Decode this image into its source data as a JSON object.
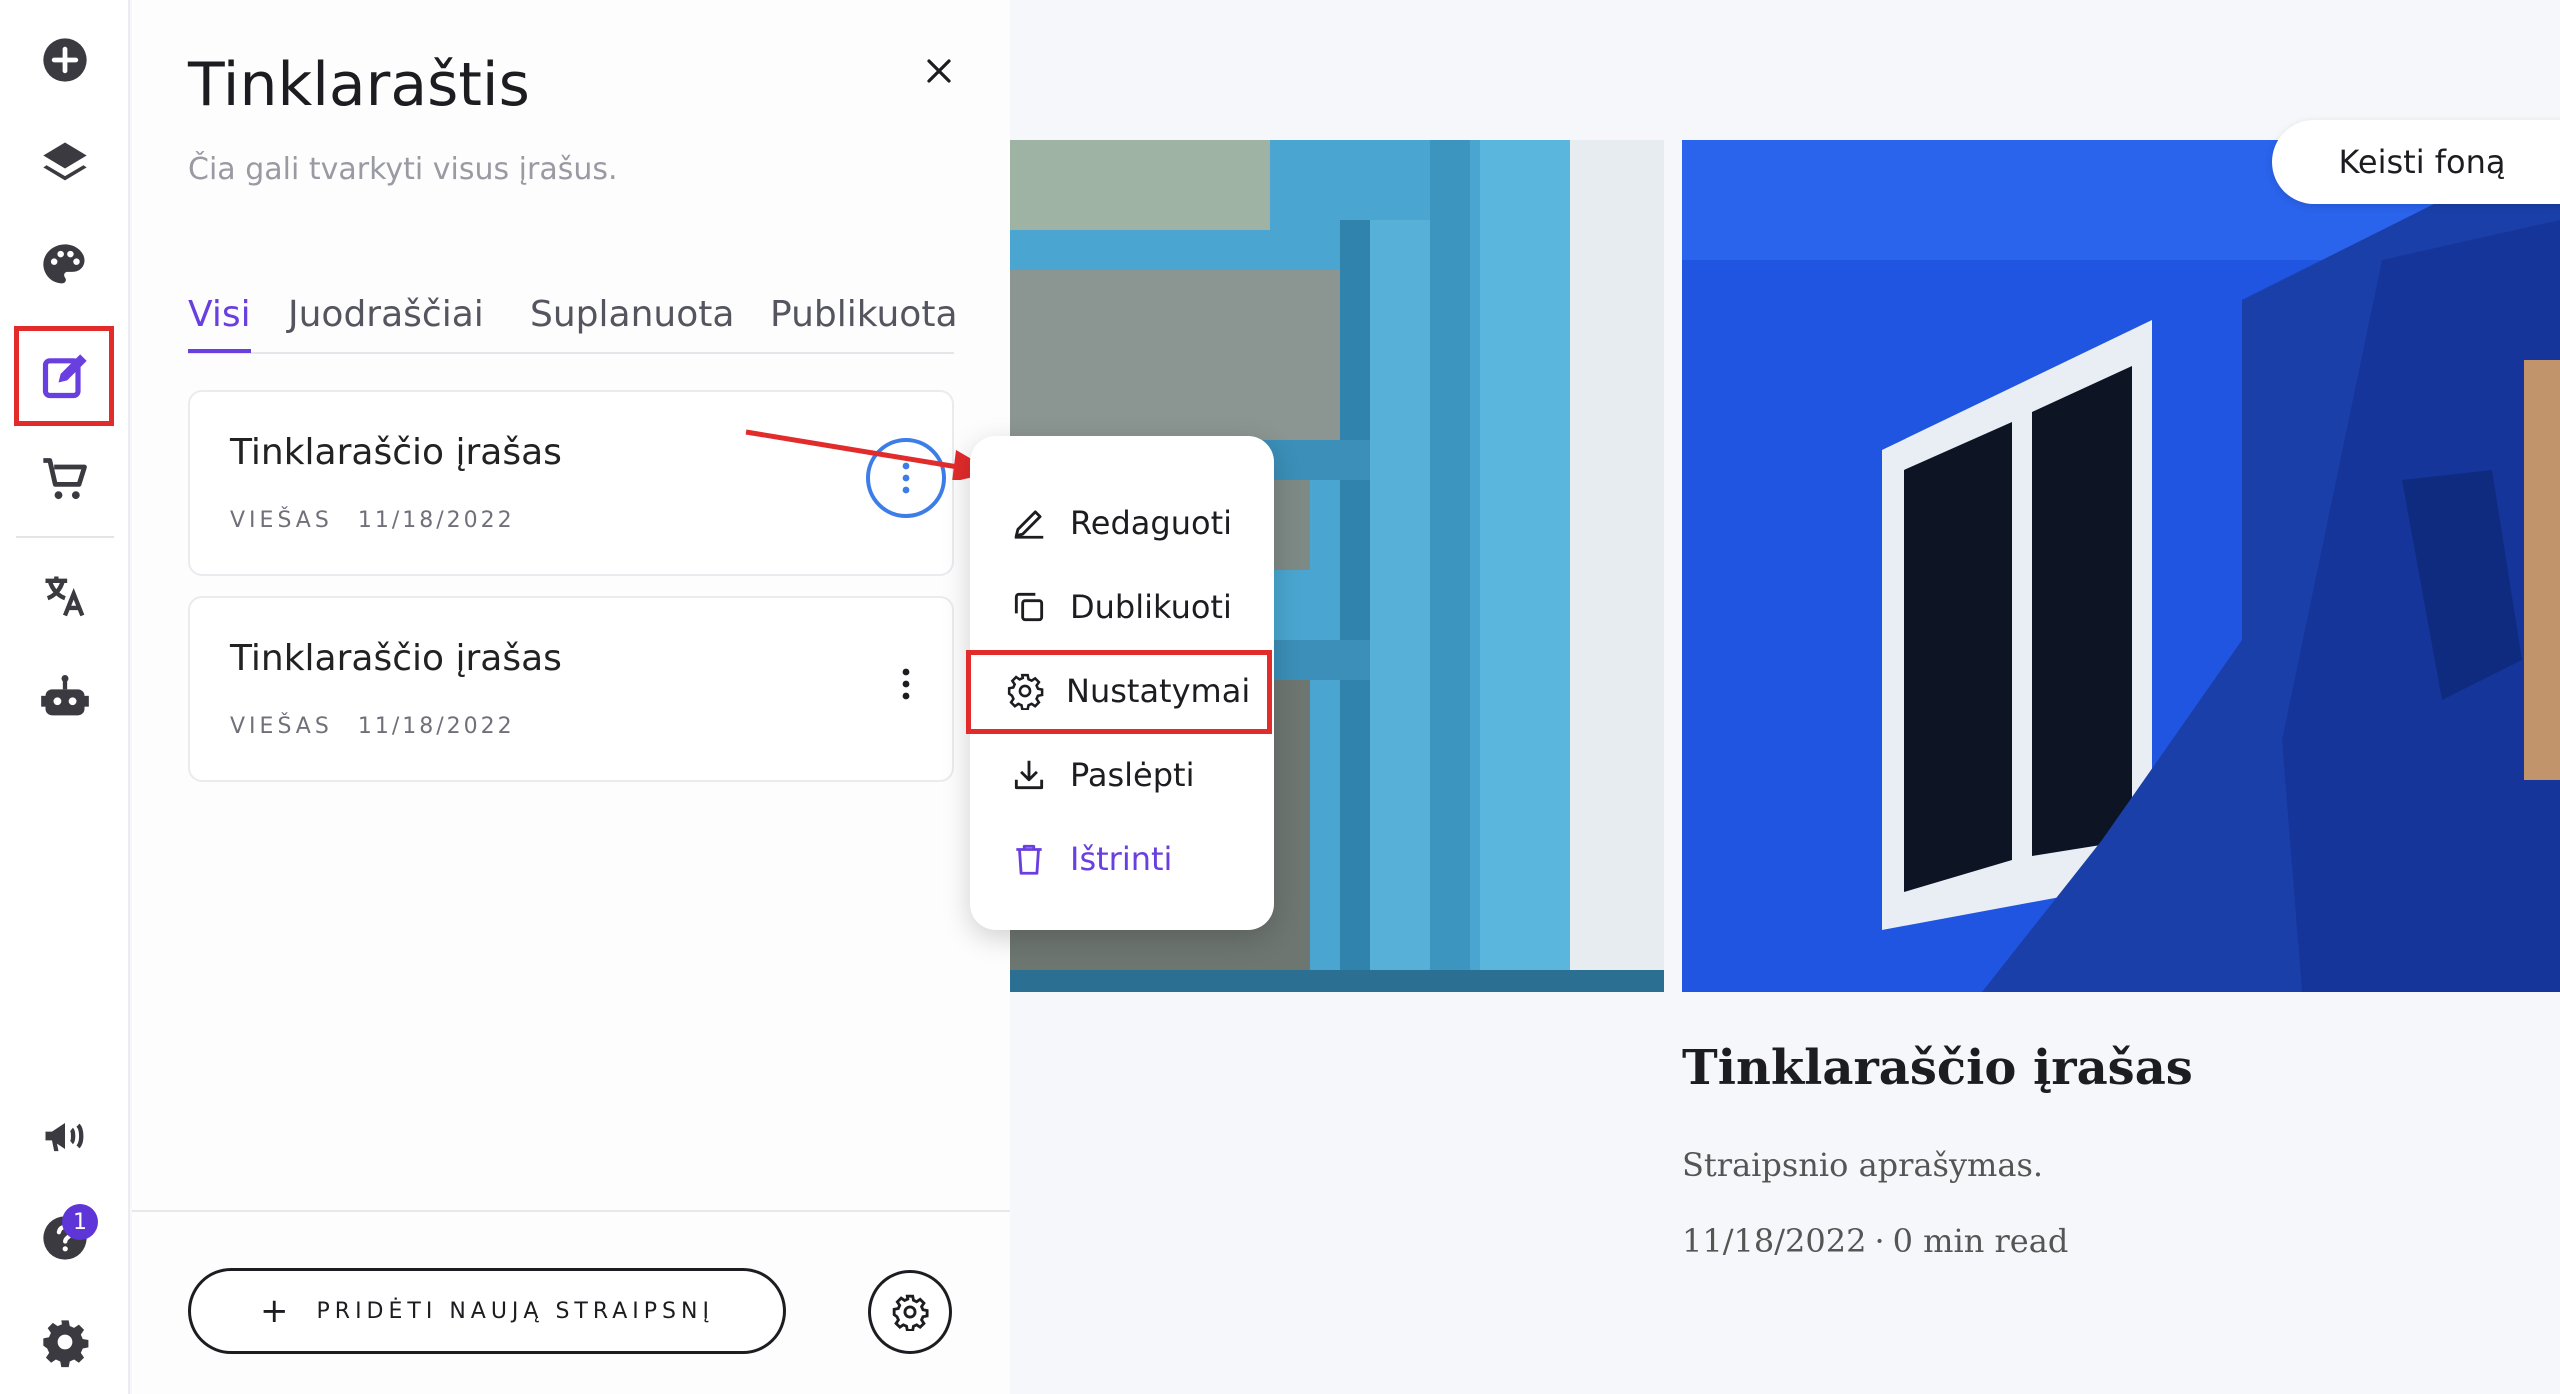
{
  "rail": {
    "badge_count": "1",
    "accent_color": "#5e35d6",
    "items": [
      {
        "icon": "plus-circle-icon"
      },
      {
        "icon": "layers-icon"
      },
      {
        "icon": "palette-icon"
      },
      {
        "icon": "edit-icon",
        "active": true
      },
      {
        "icon": "cart-icon"
      },
      {
        "icon": "translate-icon"
      },
      {
        "icon": "robot-icon"
      },
      {
        "icon": "megaphone-icon"
      },
      {
        "icon": "help-icon"
      },
      {
        "icon": "gear-icon"
      }
    ]
  },
  "panel": {
    "title": "Tinklaraštis",
    "subtitle": "Čia gali tvarkyti visus įrašus.",
    "tabs": [
      {
        "label": "Visi",
        "active": true
      },
      {
        "label": "Juodraščiai"
      },
      {
        "label": "Suplanuota"
      },
      {
        "label": "Publikuota"
      }
    ],
    "posts": [
      {
        "title": "Tinklaraščio įrašas",
        "status": "VIEŠAS",
        "date": "11/18/2022"
      },
      {
        "title": "Tinklaraščio įrašas",
        "status": "VIEŠAS",
        "date": "11/18/2022"
      }
    ],
    "add_button": "PRIDĖTI NAUJĄ STRAIPSNĮ"
  },
  "menu": {
    "items": [
      {
        "label": "Redaguoti",
        "icon": "pencil-icon"
      },
      {
        "label": "Dublikuoti",
        "icon": "duplicate-icon"
      },
      {
        "label": "Nustatymai",
        "icon": "gear-icon"
      },
      {
        "label": "Paslėpti",
        "icon": "download-icon"
      },
      {
        "label": "Ištrinti",
        "icon": "trash-icon"
      }
    ]
  },
  "preview": {
    "change_background": "Keisti foną",
    "card": {
      "title": "Tinklaraščio įrašas",
      "description": "Straipsnio aprašymas.",
      "date": "11/18/2022",
      "separator": "·",
      "read_time": "0 min read"
    }
  },
  "colors": {
    "accent": "#6a3fe0",
    "annotation": "#e22b2b",
    "focus_ring": "#3d7de8"
  }
}
